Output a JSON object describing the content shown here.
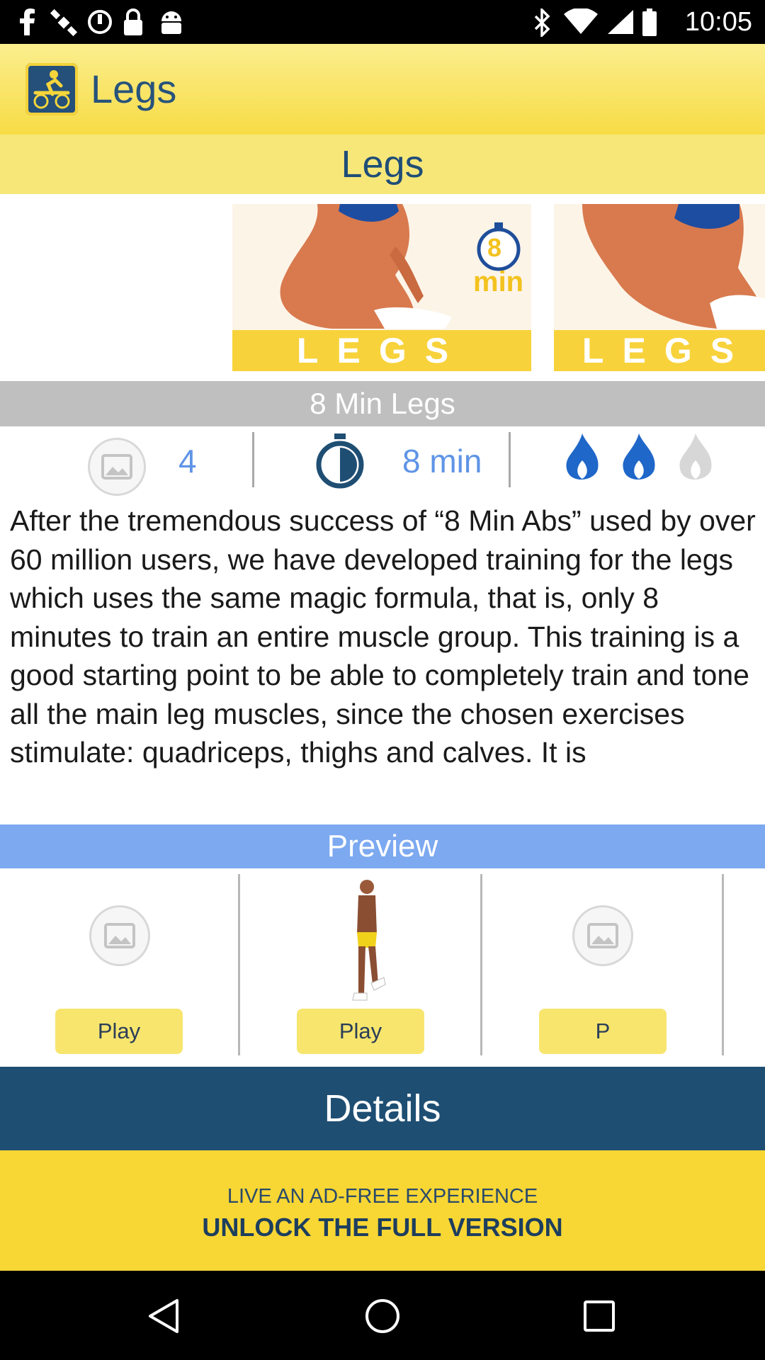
{
  "status_bar": {
    "time": "10:05",
    "icons": [
      "facebook-icon",
      "satellite-icon",
      "sync-icon",
      "lock-icon",
      "android-icon",
      "bluetooth-icon",
      "wifi-icon",
      "signal-icon",
      "battery-icon"
    ]
  },
  "app_bar": {
    "title": "Legs",
    "logo_icon": "workout-logo-icon"
  },
  "section_header": "Legs",
  "banners": [
    {
      "label": "LEGS",
      "timer_number": "8",
      "timer_unit": "min"
    },
    {
      "label": "LEGS"
    }
  ],
  "workout": {
    "title": "8 Min Legs",
    "stats": {
      "exercises_count": "4",
      "duration": "8 min",
      "intensity_level": 2,
      "intensity_max": 3
    },
    "description": "After the tremendous success of “8 Min Abs” used by over 60 million users, we have developed training for the legs which uses the same magic formula, that is, only 8 minutes to train an entire muscle group. This training is a good starting point to be able to completely train and tone all the main leg muscles, since the chosen exercises stimulate: quadriceps, thighs and calves. It is"
  },
  "preview": {
    "title": "Preview",
    "items": [
      {
        "button_label": "Play",
        "thumb": "image-placeholder-icon"
      },
      {
        "button_label": "Play",
        "thumb": "standing-man-figure"
      },
      {
        "button_label": "P",
        "thumb": "image-placeholder-icon"
      }
    ]
  },
  "details_label": "Details",
  "unlock": {
    "line1": "LIVE AN AD-FREE EXPERIENCE",
    "line2": "UNLOCK THE FULL VERSION"
  },
  "colors": {
    "accent_blue": "#5f94e6",
    "navy": "#1f4e73",
    "yellow": "#f8d634",
    "flame_active": "#1f67c8",
    "flame_inactive": "#d7d7d7"
  }
}
